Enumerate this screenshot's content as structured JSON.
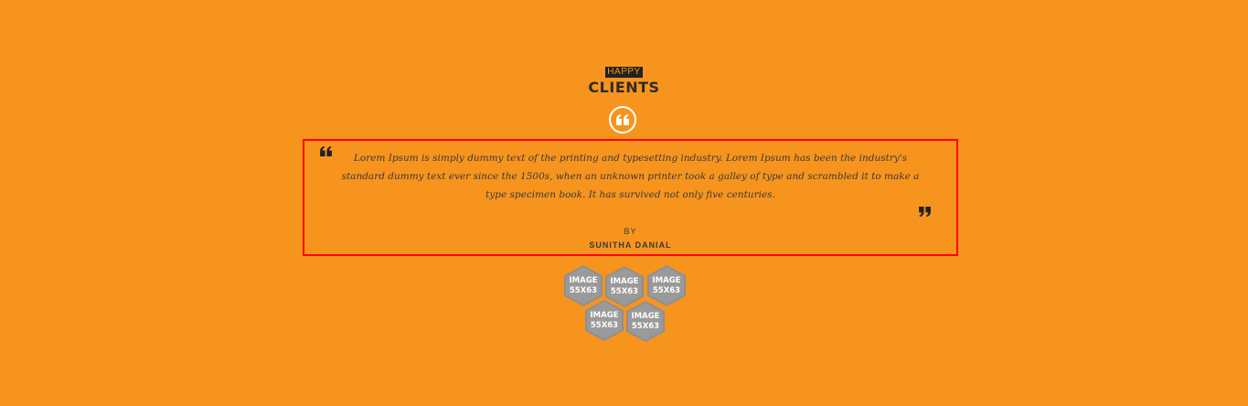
{
  "section": {
    "eyebrow": "HAPPY",
    "title": "CLIENTS"
  },
  "testimonial": {
    "text": "Lorem Ipsum is simply dummy text of the printing and typesetting industry. Lorem Ipsum has been the industry's standard dummy text ever since the 1500s, when an unknown printer took a galley of type and scrambled it to make a type specimen book. It has survived not only five centuries.",
    "by_label": "BY",
    "author": "SUNITHA DANIAL"
  },
  "clients": [
    {
      "label": "IMAGE\n55X63"
    },
    {
      "label": "IMAGE\n55X63"
    },
    {
      "label": "IMAGE\n55X63"
    },
    {
      "label": "IMAGE\n55X63"
    },
    {
      "label": "IMAGE\n55X63"
    }
  ],
  "colors": {
    "background": "#f7941e",
    "heading": "#2b2b2b",
    "highlight_border": "#ff0000",
    "client_placeholder": "#8f8f8f"
  },
  "icons": {
    "badge": "quote-icon",
    "open_quote": "quote-open-icon",
    "close_quote": "quote-close-icon"
  }
}
